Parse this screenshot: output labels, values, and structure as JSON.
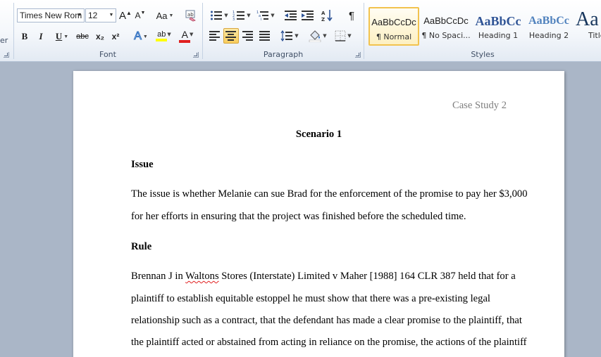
{
  "ribbon": {
    "font": {
      "label": "Font",
      "font_name": "Times New Rom",
      "font_size": "12",
      "grow_font_glyph": "A",
      "shrink_font_glyph": "A",
      "change_case_glyph": "Aa",
      "bold_glyph": "B",
      "italic_glyph": "I",
      "underline_glyph": "U",
      "strike_glyph": "abc",
      "subscript_glyph": "x₂",
      "superscript_glyph": "x²",
      "text_effects_glyph": "A",
      "highlight_glyph": "ab",
      "font_color_glyph": "A",
      "highlight_color": "#ffff00",
      "font_color": "#e02020"
    },
    "clipboard": {
      "label_fragment": "er"
    },
    "paragraph": {
      "label": "Paragraph",
      "pilcrow": "¶"
    },
    "styles": {
      "label": "Styles",
      "items": [
        {
          "preview": "AaBbCcDc",
          "name": "¶ Normal",
          "selected": true
        },
        {
          "preview": "AaBbCcDc",
          "name": "¶ No Spaci...",
          "selected": false
        },
        {
          "preview": "AaBbCc",
          "name": "Heading 1",
          "selected": false
        },
        {
          "preview": "AaBbCc",
          "name": "Heading 2",
          "selected": false
        },
        {
          "preview": "Aa",
          "name": "Title",
          "selected": false
        }
      ],
      "heading_color": "#2f5496"
    }
  },
  "document": {
    "header": "Case Study 2",
    "title": "Scenario 1",
    "issue_heading": "Issue",
    "issue_lines": [
      "The issue is whether Melanie can sue Brad for the enforcement of the promise to pay her $3,000",
      "for her efforts in ensuring that the project was finished before the scheduled time."
    ],
    "rule_heading": "Rule",
    "rule_line1_before": "Brennan J in ",
    "rule_line1_squiggle": "Waltons",
    "rule_line1_after": " Stores (Interstate) Limited v Maher [1988] 164 CLR 387 held that for a",
    "rule_lines": [
      "plaintiff to establish equitable estoppel he must show that there was a pre-existing legal",
      "relationship such as a contract, that the defendant has made a clear promise to the plaintiff, that",
      "the plaintiff acted or abstained from acting in reliance on the promise, the actions of the plaintiff"
    ]
  }
}
